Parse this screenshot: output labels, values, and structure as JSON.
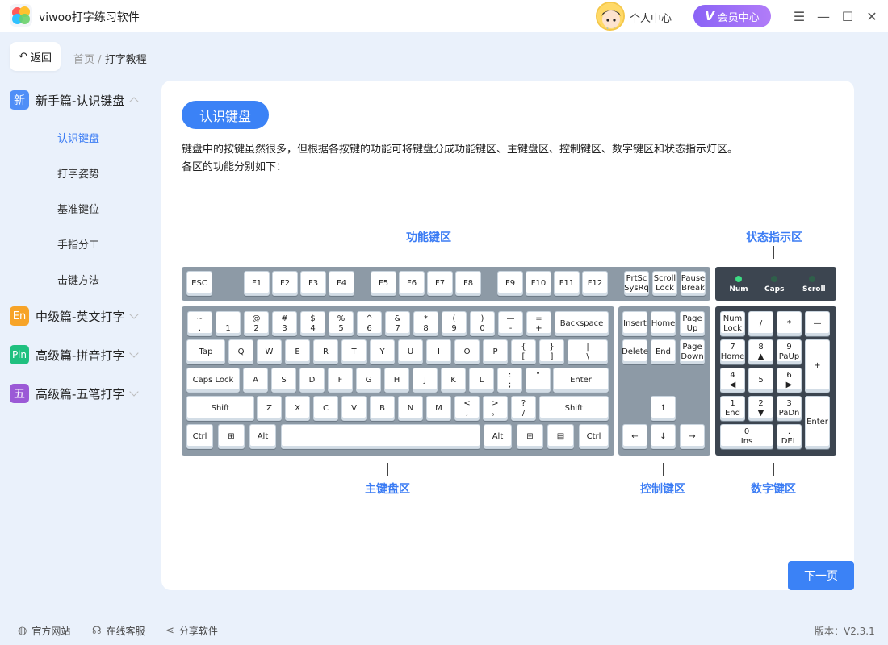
{
  "app": {
    "title": "viwoo打字练习软件",
    "user_center": "个人中心",
    "vip": "会员中心",
    "vip_mark": "V"
  },
  "window_controls": {
    "menu": "☰",
    "minimize": "—",
    "maximize": "☐",
    "close": "✕"
  },
  "nav": {
    "back_icon": "↶",
    "back": "返回",
    "breadcrumb": {
      "home": "首页",
      "sep": "/",
      "current": "打字教程"
    }
  },
  "sidebar": {
    "sections": [
      {
        "badge": "新",
        "badge_color": "#4f8ef7",
        "label": "新手篇-认识键盘",
        "expanded": true,
        "items": [
          "认识键盘",
          "打字姿势",
          "基准键位",
          "手指分工",
          "击键方法"
        ],
        "active": 0
      },
      {
        "badge": "En",
        "badge_color": "#f7a428",
        "label": "中级篇-英文打字",
        "expanded": false
      },
      {
        "badge": "Pin",
        "badge_color": "#1fc07f",
        "label": "高级篇-拼音打字",
        "expanded": false
      },
      {
        "badge": "五",
        "badge_color": "#9b59d6",
        "label": "高级篇-五笔打字",
        "expanded": false
      }
    ]
  },
  "content": {
    "tag": "认识键盘",
    "desc_line1": "键盘中的按键虽然很多，但根据各按键的功能可将键盘分成功能键区、主键盘区、控制键区、数字键区和状态指示灯区。",
    "desc_line2": "各区的功能分别如下：",
    "zones": {
      "function": "功能键区",
      "status": "状态指示区",
      "main": "主键盘区",
      "control": "控制键区",
      "numpad": "数字键区"
    },
    "next": "下一页"
  },
  "keyboard": {
    "fn_keys": [
      "ESC",
      "F1",
      "F2",
      "F3",
      "F4",
      "F5",
      "F6",
      "F7",
      "F8",
      "F9",
      "F10",
      "F11",
      "F12"
    ],
    "sys_keys": [
      [
        "PrtSc",
        "SysRq"
      ],
      [
        "Scroll",
        "Lock"
      ],
      [
        "Pause",
        "Break"
      ]
    ],
    "leds": [
      {
        "label": "Num",
        "color": "#3ddc84"
      },
      {
        "label": "Caps",
        "color": "#2f5f4a"
      },
      {
        "label": "Scroll",
        "color": "#2f5f4a"
      }
    ],
    "row1": [
      [
        "~",
        "."
      ],
      [
        "!",
        "1"
      ],
      [
        "@",
        "2"
      ],
      [
        "#",
        "3"
      ],
      [
        "$",
        "4"
      ],
      [
        "%",
        "5"
      ],
      [
        "^",
        "6"
      ],
      [
        "&",
        "7"
      ],
      [
        "*",
        "8"
      ],
      [
        "(",
        "9"
      ],
      [
        ")",
        "0"
      ],
      [
        "—",
        "-"
      ],
      [
        "=",
        "+"
      ],
      [
        "Backspace",
        ""
      ]
    ],
    "row2": [
      [
        "Tap",
        ""
      ],
      [
        "Q",
        ""
      ],
      [
        "W",
        ""
      ],
      [
        "E",
        ""
      ],
      [
        "R",
        ""
      ],
      [
        "T",
        ""
      ],
      [
        "Y",
        ""
      ],
      [
        "U",
        ""
      ],
      [
        "I",
        ""
      ],
      [
        "O",
        ""
      ],
      [
        "P",
        ""
      ],
      [
        "{",
        "["
      ],
      [
        "}",
        "]"
      ],
      [
        "|",
        "\\"
      ]
    ],
    "row3": [
      [
        "Caps Lock",
        ""
      ],
      [
        "A",
        ""
      ],
      [
        "S",
        ""
      ],
      [
        "D",
        ""
      ],
      [
        "F",
        ""
      ],
      [
        "G",
        ""
      ],
      [
        "H",
        ""
      ],
      [
        "J",
        ""
      ],
      [
        "K",
        ""
      ],
      [
        "L",
        ""
      ],
      [
        ":",
        ";"
      ],
      [
        "\"",
        "'"
      ],
      [
        "Enter",
        ""
      ]
    ],
    "row4": [
      [
        "Shift",
        ""
      ],
      [
        "Z",
        ""
      ],
      [
        "X",
        ""
      ],
      [
        "C",
        ""
      ],
      [
        "V",
        ""
      ],
      [
        "B",
        ""
      ],
      [
        "N",
        ""
      ],
      [
        "M",
        ""
      ],
      [
        "<",
        ","
      ],
      [
        ">",
        "。"
      ],
      [
        "?",
        "/"
      ],
      [
        "Shift",
        ""
      ]
    ],
    "row5": [
      [
        "Ctrl",
        ""
      ],
      [
        "⊞",
        ""
      ],
      [
        "Alt",
        ""
      ],
      [
        "",
        ""
      ],
      [
        "Alt",
        ""
      ],
      [
        "⊞",
        ""
      ],
      [
        "▤",
        ""
      ],
      [
        "Ctrl",
        ""
      ]
    ],
    "ctrl_keys": [
      [
        "Insert",
        ""
      ],
      [
        "Home",
        ""
      ],
      [
        "Page",
        "Up"
      ],
      [
        "Delete",
        ""
      ],
      [
        "End",
        ""
      ],
      [
        "Page",
        "Down"
      ],
      [
        "↑",
        ""
      ],
      [
        "←",
        ""
      ],
      [
        "↓",
        ""
      ],
      [
        "→",
        ""
      ]
    ],
    "num_keys": [
      [
        "Num",
        "Lock"
      ],
      [
        "/",
        ""
      ],
      [
        "*",
        ""
      ],
      [
        "—",
        ""
      ],
      [
        "7",
        "Home"
      ],
      [
        "8",
        "▲"
      ],
      [
        "9",
        "PaUp"
      ],
      [
        "+",
        ""
      ],
      [
        "4",
        "◀"
      ],
      [
        "5",
        ""
      ],
      [
        "6",
        "▶"
      ],
      [
        "1",
        "End"
      ],
      [
        "2",
        "▼"
      ],
      [
        "3",
        "PaDn"
      ],
      [
        "Enter",
        ""
      ],
      [
        "0",
        "Ins"
      ],
      [
        ".",
        "DEL"
      ]
    ]
  },
  "footer": {
    "links": [
      {
        "icon": "◍",
        "label": "官方网站"
      },
      {
        "icon": "☊",
        "label": "在线客服"
      },
      {
        "icon": "⋖",
        "label": "分享软件"
      }
    ],
    "version": "版本：V2.3.1"
  }
}
